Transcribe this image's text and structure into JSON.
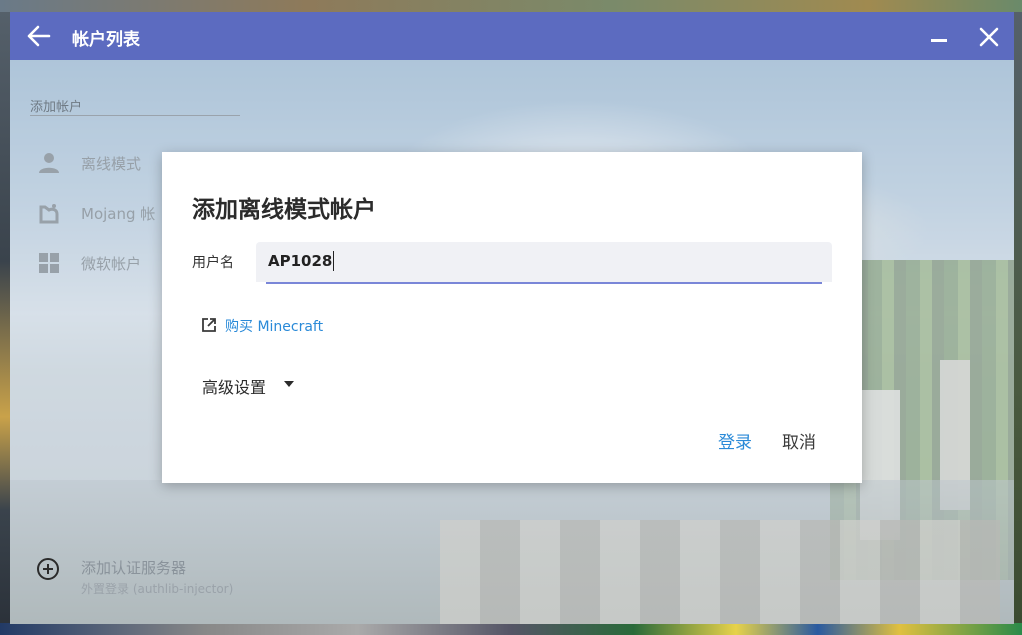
{
  "window": {
    "title": "帐户列表",
    "accent": "#5c6bc0"
  },
  "sidebar": {
    "add_header": "添加帐户",
    "items": [
      {
        "label": "离线模式",
        "icon": "person-icon"
      },
      {
        "label": "Mojang 帐",
        "icon": "mojang-icon"
      },
      {
        "label": "微软帐户",
        "icon": "windows-icon"
      }
    ],
    "auth_server": {
      "label": "添加认证服务器",
      "sublabel": "外置登录 (authlib-injector)",
      "icon": "add-circle-icon"
    }
  },
  "dialog": {
    "title": "添加离线模式帐户",
    "username_label": "用户名",
    "username_value": "AP1028",
    "buy_link": "购买 Minecraft",
    "advanced": "高级设置",
    "login_button": "登录",
    "cancel_button": "取消",
    "link_color": "#2a8ad8"
  }
}
